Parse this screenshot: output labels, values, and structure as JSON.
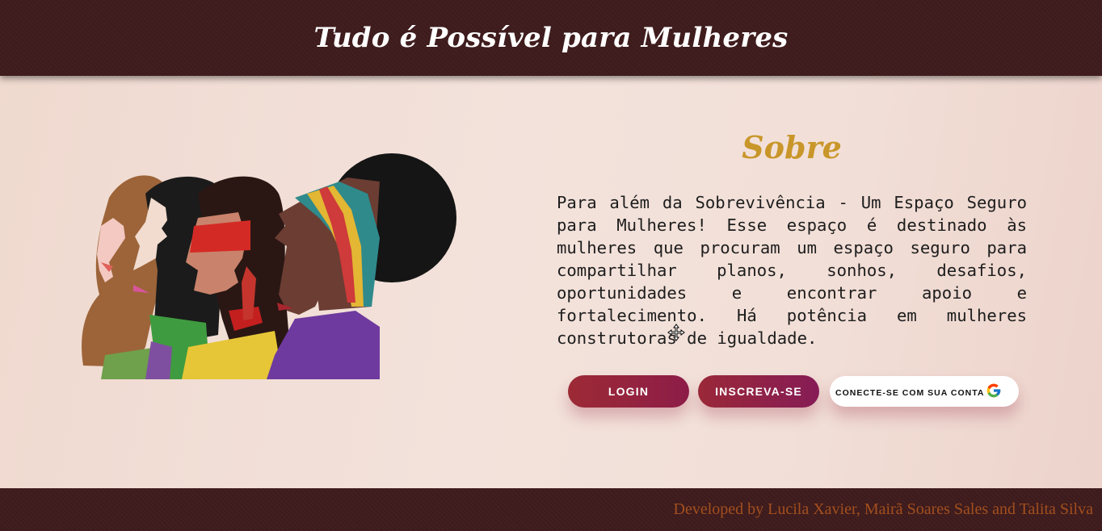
{
  "header": {
    "title": "Tudo é Possível para Mulheres"
  },
  "illustration": {
    "icon": "women-profiles-illustration"
  },
  "about": {
    "title": "Sobre",
    "text": "Para além da Sobrevivência - Um Espaço Seguro para Mulheres! Esse espaço é destinado às mulheres que procuram um espaço seguro para compartilhar planos, sonhos, desafios, oportunidades e encontrar apoio e fortalecimento. Há potência em mulheres construtoras de igualdade."
  },
  "actions": {
    "login_label": "LOGIN",
    "signup_label": "INSCREVA-SE",
    "google_label": "CONECTE-SE COM SUA CONTA"
  },
  "footer": {
    "credits": "Developed by Lucila Xavier, Mairã Soares Sales and Talita Silva"
  },
  "colors": {
    "header_bg": "#3d1a1b",
    "title_gold": "#c9962a",
    "button_red": "#9c2a35",
    "footer_text": "#a24f1e"
  }
}
